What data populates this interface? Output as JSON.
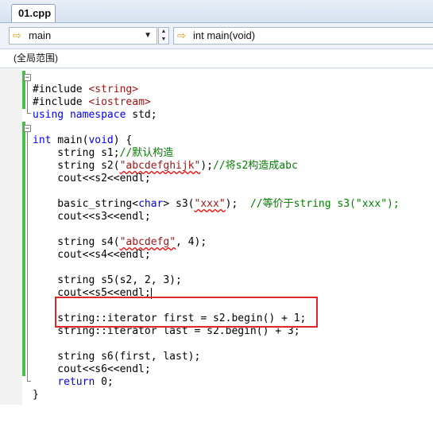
{
  "tab": {
    "filename": "01.cpp"
  },
  "nav": {
    "scope_combo": "main",
    "function_combo": "int main(void)"
  },
  "scope_bar": {
    "label": "(全局范围)"
  },
  "code": {
    "l1a": "#include ",
    "l1b": "<string>",
    "l2a": "#include ",
    "l2b": "<iostream>",
    "l3a": "using",
    "l3b": " ",
    "l3c": "namespace",
    "l3d": " std;",
    "l5a": "int",
    "l5b": " main(",
    "l5c": "void",
    "l5d": ") {",
    "l6a": "    string s1;",
    "l6b": "//默认构造",
    "l7a": "    string s2(",
    "l7b": "\"abcdefghijk\"",
    "l7c": ");",
    "l7d": "//将s2构造成abc",
    "l8": "    cout<<s2<<endl;",
    "l10a": "    basic_string<",
    "l10b": "char",
    "l10c": "> s3(",
    "l10d": "\"xxx\"",
    "l10e": ");  ",
    "l10f": "//等价于string s3(\"xxx\");",
    "l11": "    cout<<s3<<endl;",
    "l13a": "    string s4(",
    "l13b": "\"abcdefg\"",
    "l13c": ", 4);",
    "l14": "    cout<<s4<<endl;",
    "l16": "    string s5(s2, 2, 3);",
    "l17": "    cout<<s5<<endl;",
    "l19": "    string::iterator first = s2.begin() + 1;",
    "l20": "    string::iterator last = s2.begin() + 3;",
    "l22": "    string s6(first, last);",
    "l23": "    cout<<s6<<endl;",
    "l24a": "    ",
    "l24b": "return",
    "l24c": " 0;",
    "l25": "}"
  },
  "icons": {
    "scope_icon": "arrow-right-icon",
    "function_icon": "arrow-right-icon",
    "dropdown": "chevron-down-icon"
  }
}
